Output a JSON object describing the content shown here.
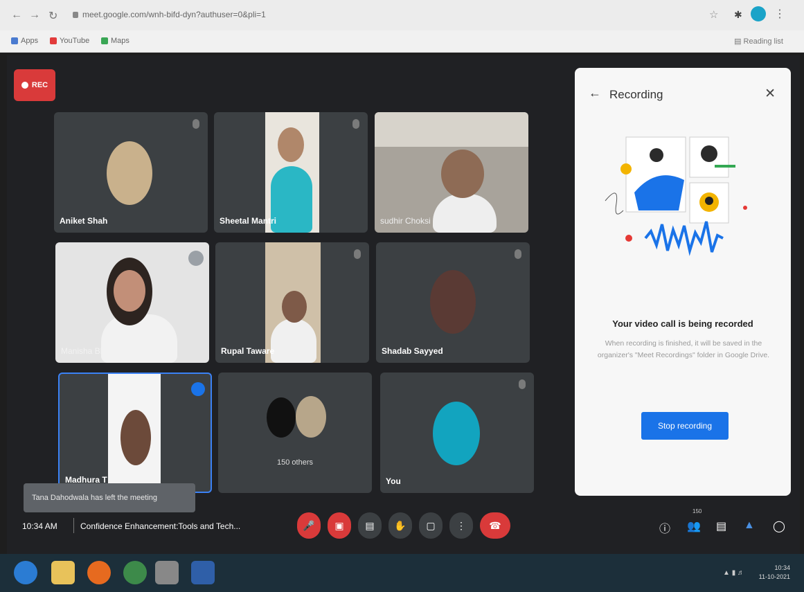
{
  "browser": {
    "url": "meet.google.com/wnh-bifd-dyn?authuser=0&pli=1",
    "bookmarks": [
      "Apps",
      "YouTube",
      "Maps"
    ],
    "reading_list": "Reading list",
    "icons": [
      "back-icon",
      "forward-icon",
      "reload-icon",
      "star-icon",
      "extensions-icon",
      "profile-icon",
      "menu-icon"
    ]
  },
  "meet": {
    "rec_label": "REC",
    "tiles": [
      {
        "name": "Aniket Shah"
      },
      {
        "name": "Sheetal Mantri"
      },
      {
        "name": "sudhir Choksi"
      },
      {
        "name": "Manisha Bhati"
      },
      {
        "name": "Rupal Taware"
      },
      {
        "name": "Shadab Sayyed"
      },
      {
        "name": "Madhura T"
      },
      {
        "name": "150 others"
      },
      {
        "name": "You"
      }
    ],
    "toast": "Tana Dahodwala has left the meeting",
    "bottom": {
      "time": "10:34 AM",
      "title": "Confidence Enhancement:Tools and Tech...",
      "participant_count": "150"
    }
  },
  "panel": {
    "title": "Recording",
    "heading": "Your video call is being recorded",
    "description": "When recording is finished, it will be saved in the organizer's \"Meet Recordings\" folder in Google Drive.",
    "stop_label": "Stop recording"
  },
  "taskbar": {
    "clock_time": "10:34",
    "clock_date": "11-10-2021"
  },
  "colors": {
    "meet_bg": "#202124",
    "tile_bg": "#3c4043",
    "rec_red": "#d93a3a",
    "blue": "#1a73e8",
    "teal": "#12a4bf"
  }
}
